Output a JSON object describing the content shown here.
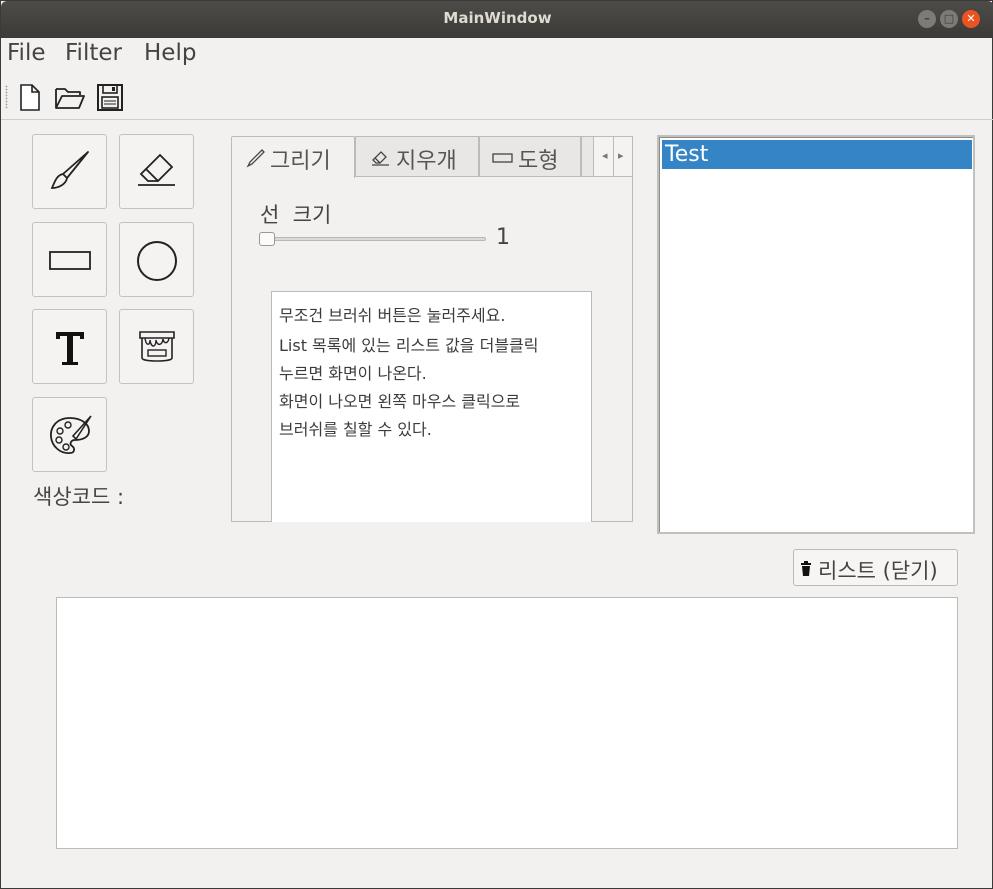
{
  "window": {
    "title": "MainWindow"
  },
  "menu": [
    "File",
    "Filter",
    "Help"
  ],
  "toolbar": {
    "icons": [
      "new-file-icon",
      "open-folder-icon",
      "save-icon"
    ]
  },
  "tools": {
    "icons": [
      "brush-icon",
      "eraser-icon",
      "rectangle-icon",
      "circle-icon",
      "text-icon",
      "paint-bucket-icon",
      "palette-icon"
    ],
    "color_label": "색상코드 :"
  },
  "tabs": [
    {
      "label": "그리기",
      "icon": "pencil-icon",
      "active": true
    },
    {
      "label": "지우개",
      "icon": "eraser-icon",
      "active": false
    },
    {
      "label": "도형",
      "icon": "rectangle-icon",
      "active": false
    }
  ],
  "draw_tab": {
    "line_size_label": "선  크기",
    "line_size_value": "1",
    "description": [
      "무조건 브러쉬 버튼은 눌러주세요.",
      "List 목록에 있는 리스트 값을 더블클릭",
      "누르면 화면이 나온다.",
      "화면이 나오면 왼쪽 마우스 클릭으로",
      "브러쉬를 칠할 수 있다."
    ]
  },
  "list": {
    "items": [
      "Test"
    ],
    "selected": "Test"
  },
  "close_list_button": {
    "label": "리스트 (닫기)",
    "icon": "trash-icon"
  },
  "colors": {
    "selection": "#3584c6",
    "title_bar": "#3d3c39",
    "close_button": "#e95420"
  }
}
